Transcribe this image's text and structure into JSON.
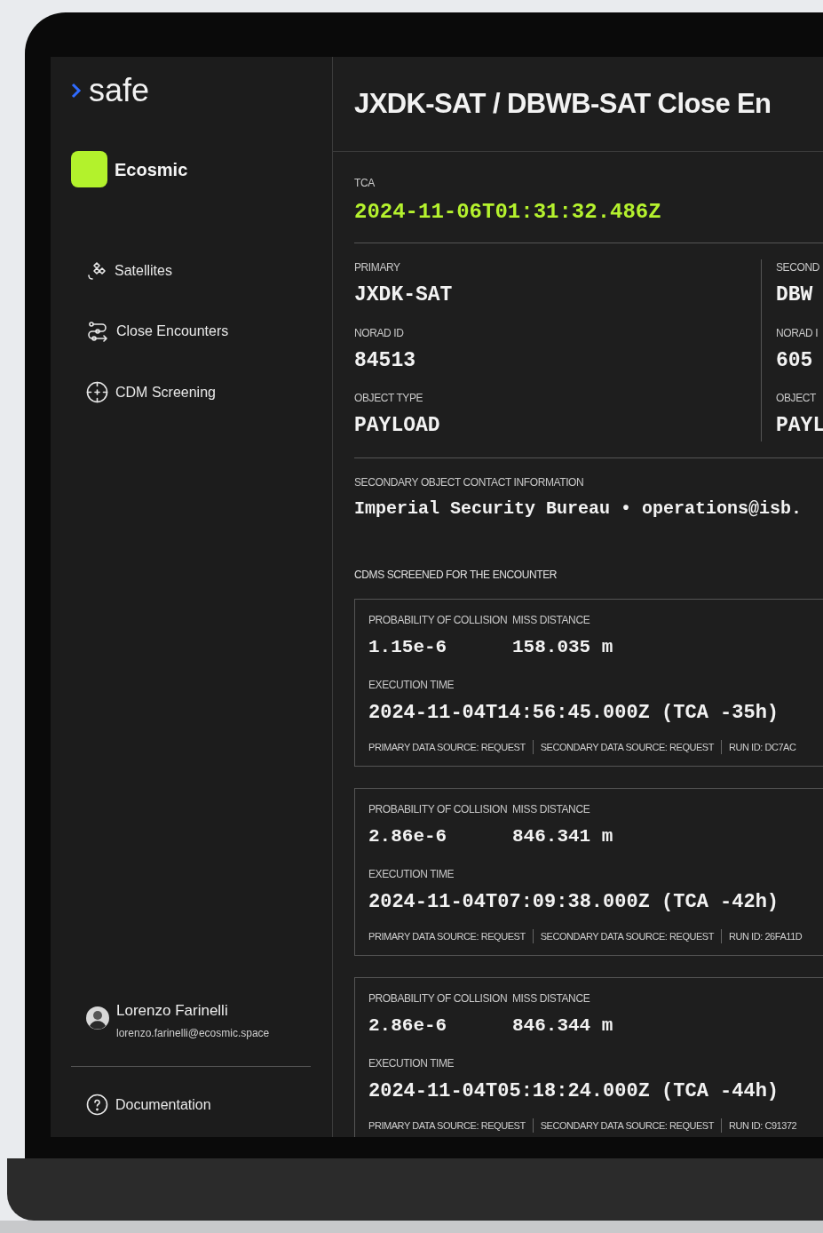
{
  "sidebar": {
    "logo": "safe",
    "workspace": "Ecosmic",
    "items": [
      {
        "label": "Satellites"
      },
      {
        "label": "Close Encounters"
      },
      {
        "label": "CDM Screening"
      }
    ],
    "user": {
      "name": "Lorenzo Farinelli",
      "email": "lorenzo.farinelli@ecosmic.space"
    },
    "footer_link": "Documentation"
  },
  "header": {
    "title": "JXDK-SAT / DBWB-SAT Close En"
  },
  "tca": {
    "label": "TCA",
    "value": "2024-11-06T01:31:32.486Z"
  },
  "objects": [
    {
      "heading": "PRIMARY",
      "name": "JXDK-SAT",
      "norad_label": "NORAD ID",
      "norad": "84513",
      "type_label": "OBJECT TYPE",
      "type": "PAYLOAD"
    },
    {
      "heading": "SECOND",
      "name": "DBW",
      "norad_label": "NORAD I",
      "norad": "605",
      "type_label": "OBJECT",
      "type": "PAYL"
    }
  ],
  "contact": {
    "label": "SECONDARY OBJECT CONTACT INFORMATION",
    "org": "Imperial Security Bureau",
    "separator": "•",
    "email": "operations@isb."
  },
  "cdms": {
    "heading": "CDMS SCREENED FOR THE ENCOUNTER",
    "cards": [
      {
        "poc_label": "PROBABILITY OF COLLISION",
        "poc": "1.15e-6",
        "miss_label": "MISS DISTANCE",
        "miss": "158.035 m",
        "exec_label": "EXECUTION TIME",
        "exec": "2024-11-04T14:56:45.000Z (TCA -35h)",
        "meta": [
          "PRIMARY DATA SOURCE: REQUEST",
          "SECONDARY DATA SOURCE: REQUEST",
          "RUN ID: DC7AC"
        ]
      },
      {
        "poc_label": "PROBABILITY OF COLLISION",
        "poc": "2.86e-6",
        "miss_label": "MISS DISTANCE",
        "miss": "846.341 m",
        "exec_label": "EXECUTION TIME",
        "exec": "2024-11-04T07:09:38.000Z (TCA -42h)",
        "meta": [
          "PRIMARY DATA SOURCE: REQUEST",
          "SECONDARY DATA SOURCE: REQUEST",
          "RUN ID: 26FA11D"
        ]
      },
      {
        "poc_label": "PROBABILITY OF COLLISION",
        "poc": "2.86e-6",
        "miss_label": "MISS DISTANCE",
        "miss": "846.344 m",
        "exec_label": "EXECUTION TIME",
        "exec": "2024-11-04T05:18:24.000Z (TCA -44h)",
        "meta": [
          "PRIMARY DATA SOURCE: REQUEST",
          "SECONDARY DATA SOURCE: REQUEST",
          "RUN ID: C91372"
        ]
      }
    ]
  }
}
